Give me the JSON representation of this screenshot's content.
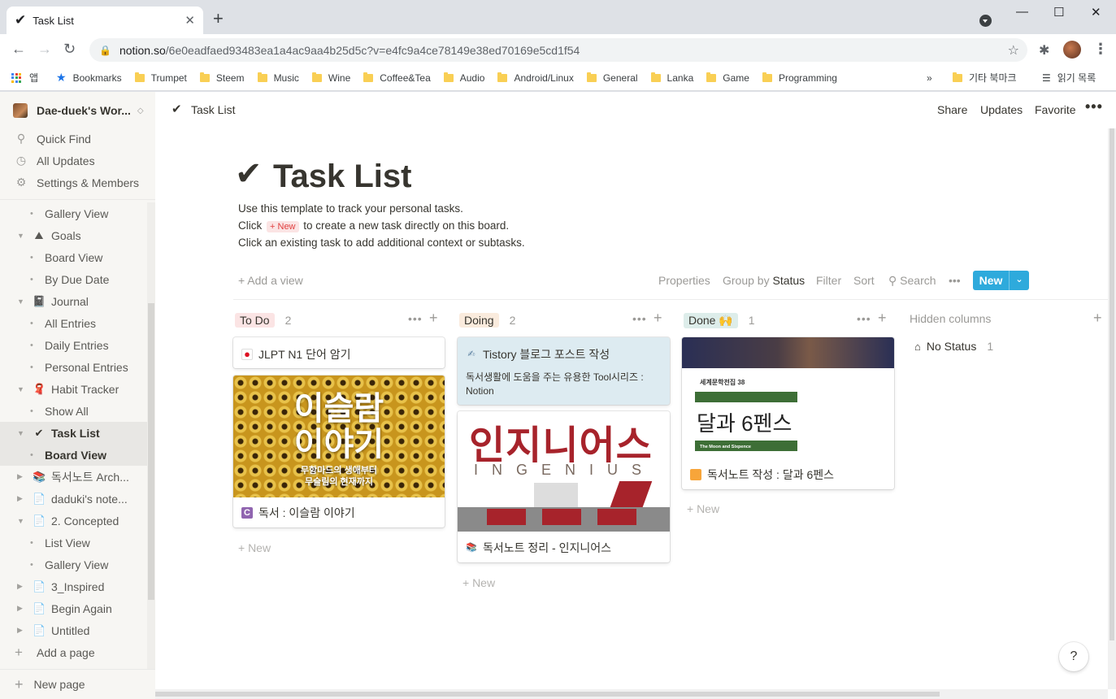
{
  "browser": {
    "tab_title": "Task List",
    "tab_icon": "✔",
    "url_host": "notion.so",
    "url_path": "/6e0eadfaed93483ea1a4ac9aa4b25d5c?v=e4fc9a4ce78149e38ed70169e5cd1f54",
    "bookmarks": [
      "앱",
      "Bookmarks",
      "Trumpet",
      "Steem",
      "Music",
      "Wine",
      "Coffee&Tea",
      "Audio",
      "Android/Linux",
      "General",
      "Lanka",
      "Game",
      "Programming"
    ],
    "bookmarks_overflow": "»",
    "other_bookmarks": "기타 북마크",
    "reading_list": "읽기 목록"
  },
  "sidebar": {
    "workspace": "Dae-duek's Wor...",
    "top_items": [
      "Quick Find",
      "All Updates",
      "Settings & Members"
    ],
    "tree": [
      {
        "label": "Gallery View",
        "kind": "child"
      },
      {
        "label": "Goals",
        "kind": "parent",
        "icon": "⛰"
      },
      {
        "label": "Board View",
        "kind": "child"
      },
      {
        "label": "By Due Date",
        "kind": "child"
      },
      {
        "label": "Journal",
        "kind": "parent",
        "icon": "📓"
      },
      {
        "label": "All Entries",
        "kind": "child"
      },
      {
        "label": "Daily Entries",
        "kind": "child"
      },
      {
        "label": "Personal Entries",
        "kind": "child"
      },
      {
        "label": "Habit Tracker",
        "kind": "parent",
        "icon": "🧣"
      },
      {
        "label": "Show All",
        "kind": "child"
      },
      {
        "label": "Task List",
        "kind": "parent",
        "icon": "✔",
        "selected": true
      },
      {
        "label": "Board View",
        "kind": "child",
        "selected": true
      },
      {
        "label": "독서노트 Arch...",
        "kind": "parent",
        "icon": "📚",
        "collapsed": true
      },
      {
        "label": "daduki's note...",
        "kind": "parent",
        "icon": "📄",
        "collapsed": true
      },
      {
        "label": "2. Concepted",
        "kind": "parent",
        "icon": "📄"
      },
      {
        "label": "List View",
        "kind": "child"
      },
      {
        "label": "Gallery View",
        "kind": "child"
      },
      {
        "label": "3_Inspired",
        "kind": "parent",
        "icon": "📄",
        "collapsed": true
      },
      {
        "label": "Begin Again",
        "kind": "parent",
        "icon": "📄",
        "collapsed": true
      },
      {
        "label": "Untitled",
        "kind": "parent",
        "icon": "📄",
        "collapsed": true
      },
      {
        "label": "Add a page",
        "kind": "add"
      }
    ],
    "new_page": "New page"
  },
  "topbar": {
    "crumb_icon": "✔",
    "crumb": "Task List",
    "share": "Share",
    "updates": "Updates",
    "favorite": "Favorite",
    "more": "•••"
  },
  "page": {
    "icon": "✔",
    "title": "Task List",
    "desc1": "Use this template to track your personal tasks.",
    "desc2_before": "Click",
    "desc2_chip": "+ New",
    "desc2_after": "to create a new task directly on this board.",
    "desc3": "Click an existing task to add additional context or subtasks."
  },
  "viewbar": {
    "add_view": "+ Add a view",
    "properties": "Properties",
    "group_by": "Group by",
    "group_value": "Status",
    "filter": "Filter",
    "sort": "Sort",
    "search": "Search",
    "more": "•••",
    "new": "New",
    "new_caret": "⌄"
  },
  "board": {
    "columns": [
      {
        "name": "To Do",
        "count": "2",
        "tag_color": "#fbe4e4",
        "cards": [
          {
            "title": "JLPT N1 단어 암기",
            "icon": "jp-flag"
          },
          {
            "title": "독서 : 이슬람 이야기",
            "icon": "book-icon",
            "cover_big1": "이슬람",
            "cover_big2": "이야기",
            "cover_small1": "무함마드의 생애부터",
            "cover_small2": "무슬림의 현재까지"
          }
        ]
      },
      {
        "name": "Doing",
        "count": "2",
        "tag_color": "#faebdd",
        "cards": [
          {
            "title": "Tistory 블로그 포스트 작성",
            "icon": "pen-icon",
            "subtitle1": "독서생활에 도움을 주는 유용한 Tool시리즈 :",
            "subtitle2": "Notion",
            "bg": "#ddebf1"
          },
          {
            "title": "독서노트 정리 - 인지니어스",
            "icon": "books-icon",
            "cover_kor": "인지니어스",
            "cover_eng": "INGENIUS"
          }
        ]
      },
      {
        "name": "Done 🙌",
        "count": "1",
        "tag_color": "#ddedea",
        "cards": [
          {
            "title": "독서노트 작성 : 달과 6펜스",
            "icon": "orange-book-icon",
            "cover_series": "세계문학전집 38",
            "cover_kor": "달과 6펜스",
            "cover_eng": "The Moon and Sixpence"
          }
        ]
      }
    ],
    "add_new": "+ New",
    "hidden_columns": "Hidden columns",
    "no_status": "No Status",
    "no_status_count": "1"
  },
  "help": "?"
}
